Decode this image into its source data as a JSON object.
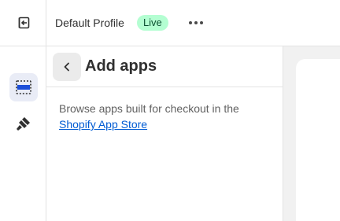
{
  "header": {
    "profile_name": "Default Profile",
    "status_badge": "Live"
  },
  "panel": {
    "title": "Add apps",
    "description": "Browse apps built for checkout in the",
    "link_text": "Shopify App Store"
  },
  "rail": {
    "icons": [
      "exit-icon",
      "sections-icon",
      "apps-icon"
    ]
  }
}
